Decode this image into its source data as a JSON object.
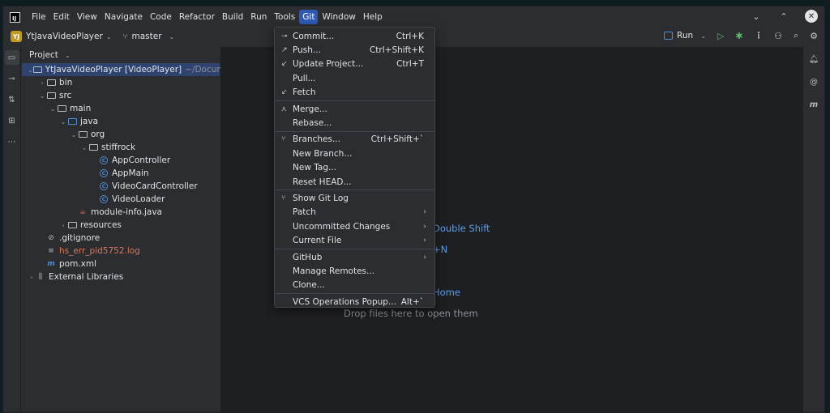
{
  "menubar": {
    "items": [
      "File",
      "Edit",
      "View",
      "Navigate",
      "Code",
      "Refactor",
      "Build",
      "Run",
      "Tools",
      "Git",
      "Window",
      "Help"
    ],
    "active": "Git"
  },
  "toolbar": {
    "project_badge": "YJ",
    "project_name": "YtJavaVideoPlayer",
    "branch": "master",
    "run_label": "Run"
  },
  "project_panel": {
    "title": "Project",
    "tree": [
      {
        "depth": 0,
        "arrow": "down",
        "icon": "folder",
        "name": "YtJavaVideoPlayer [VideoPlayer]",
        "path": "~/Documents",
        "selected": true
      },
      {
        "depth": 1,
        "arrow": "right",
        "icon": "folder",
        "name": "bin"
      },
      {
        "depth": 1,
        "arrow": "down",
        "icon": "folder",
        "name": "src"
      },
      {
        "depth": 2,
        "arrow": "down",
        "icon": "folder",
        "name": "main"
      },
      {
        "depth": 3,
        "arrow": "down",
        "icon": "folder-blue",
        "name": "java"
      },
      {
        "depth": 4,
        "arrow": "down",
        "icon": "folder",
        "name": "org"
      },
      {
        "depth": 5,
        "arrow": "down",
        "icon": "folder",
        "name": "stiffrock"
      },
      {
        "depth": 6,
        "arrow": "none",
        "icon": "class",
        "name": "AppController"
      },
      {
        "depth": 6,
        "arrow": "none",
        "icon": "class",
        "name": "AppMain"
      },
      {
        "depth": 6,
        "arrow": "none",
        "icon": "class",
        "name": "VideoCardController"
      },
      {
        "depth": 6,
        "arrow": "none",
        "icon": "class",
        "name": "VideoLoader"
      },
      {
        "depth": 4,
        "arrow": "none",
        "icon": "java-file",
        "name": "module-info.java"
      },
      {
        "depth": 3,
        "arrow": "right",
        "icon": "folder",
        "name": "resources"
      },
      {
        "depth": 1,
        "arrow": "none",
        "icon": "ignore-file",
        "name": ".gitignore"
      },
      {
        "depth": 1,
        "arrow": "none",
        "icon": "text-file",
        "name": "hs_err_pid5752.log",
        "red": true
      },
      {
        "depth": 1,
        "arrow": "none",
        "icon": "maven-file",
        "name": "pom.xml"
      },
      {
        "depth": 0,
        "arrow": "right",
        "icon": "libraries",
        "name": "External Libraries"
      }
    ]
  },
  "editor_hints": {
    "search": "Double Shift",
    "new": "+N",
    "home": "Home",
    "drop": "Drop files here to open them"
  },
  "git_menu": {
    "groups": [
      [
        {
          "icon": "commit-icon",
          "glyph": "⊸",
          "label": "Commit...",
          "shortcut": "Ctrl+K"
        },
        {
          "icon": "push-icon",
          "glyph": "↗",
          "label": "Push...",
          "shortcut": "Ctrl+Shift+K"
        },
        {
          "icon": "update-icon",
          "glyph": "↙",
          "label": "Update Project...",
          "shortcut": "Ctrl+T"
        },
        {
          "icon": "",
          "glyph": "",
          "label": "Pull...",
          "shortcut": ""
        },
        {
          "icon": "fetch-icon",
          "glyph": "↙",
          "label": "Fetch",
          "shortcut": ""
        }
      ],
      [
        {
          "icon": "merge-icon",
          "glyph": "⋏",
          "label": "Merge...",
          "shortcut": ""
        },
        {
          "icon": "",
          "glyph": "",
          "label": "Rebase...",
          "shortcut": ""
        }
      ],
      [
        {
          "icon": "branch-icon",
          "glyph": "⑂",
          "label": "Branches...",
          "shortcut": "Ctrl+Shift+`"
        },
        {
          "icon": "",
          "glyph": "",
          "label": "New Branch...",
          "shortcut": ""
        },
        {
          "icon": "",
          "glyph": "",
          "label": "New Tag...",
          "shortcut": ""
        },
        {
          "icon": "",
          "glyph": "",
          "label": "Reset HEAD...",
          "shortcut": ""
        }
      ],
      [
        {
          "icon": "git-log-icon",
          "glyph": "⑂",
          "label": "Show Git Log",
          "shortcut": ""
        },
        {
          "icon": "",
          "glyph": "",
          "label": "Patch",
          "shortcut": "",
          "submenu": true
        },
        {
          "icon": "",
          "glyph": "",
          "label": "Uncommitted Changes",
          "shortcut": "",
          "submenu": true
        },
        {
          "icon": "",
          "glyph": "",
          "label": "Current File",
          "shortcut": "",
          "submenu": true
        }
      ],
      [
        {
          "icon": "",
          "glyph": "",
          "label": "GitHub",
          "shortcut": "",
          "submenu": true
        },
        {
          "icon": "",
          "glyph": "",
          "label": "Manage Remotes...",
          "shortcut": ""
        },
        {
          "icon": "",
          "glyph": "",
          "label": "Clone...",
          "shortcut": ""
        }
      ],
      [
        {
          "icon": "",
          "glyph": "",
          "label": "VCS Operations Popup...",
          "shortcut": "Alt+`"
        }
      ]
    ]
  }
}
